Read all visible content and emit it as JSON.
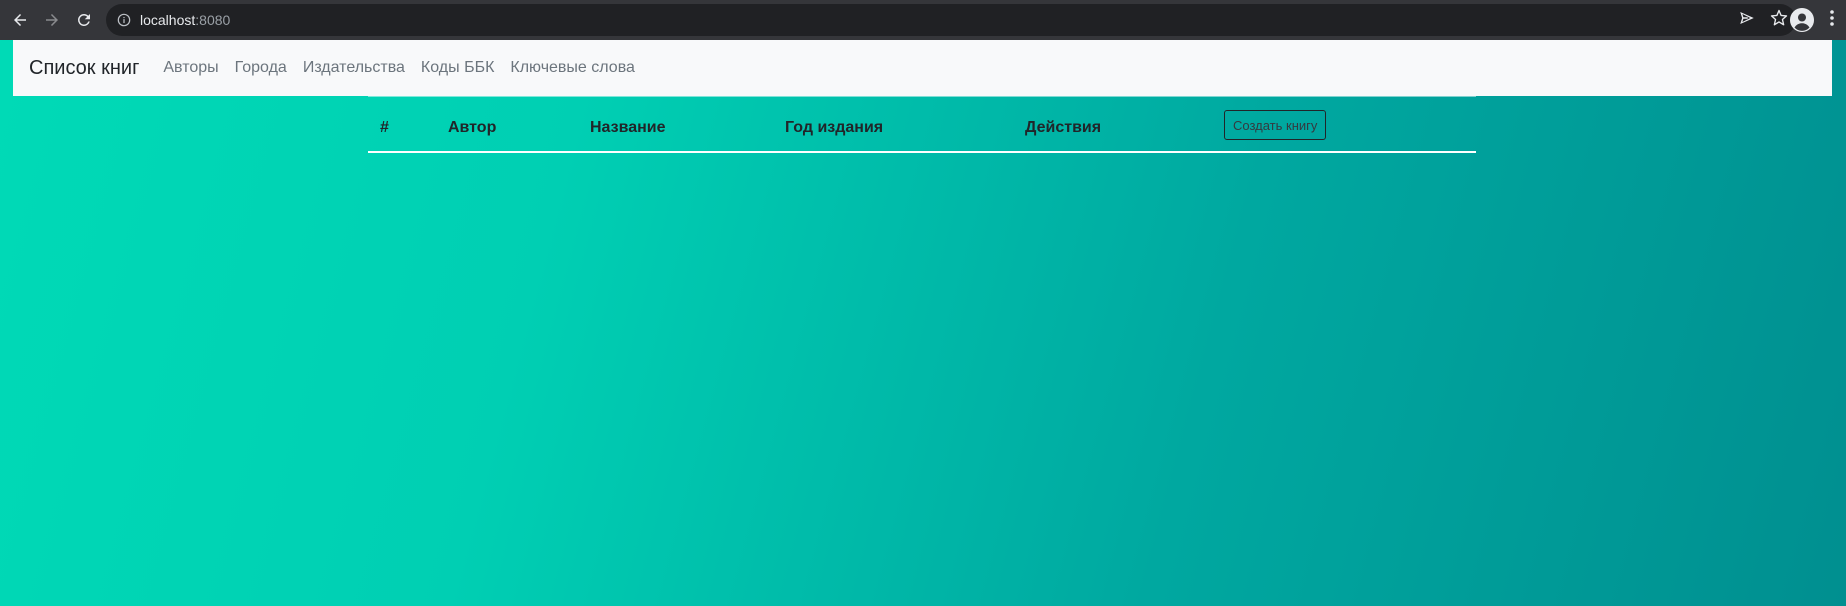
{
  "browser": {
    "url_host": "localhost",
    "url_port": ":8080"
  },
  "navbar": {
    "brand": "Список книг",
    "links": [
      "Авторы",
      "Города",
      "Издательства",
      "Коды ББК",
      "Ключевые слова"
    ]
  },
  "table": {
    "headers": [
      "#",
      "Автор",
      "Название",
      "Год издания",
      "Действия"
    ],
    "create_button": "Создать книгу",
    "rows": []
  },
  "colors": {
    "navbar_bg": "#f8f9fa",
    "gradient_start": "#00dab6",
    "gradient_end": "#008f90"
  },
  "icons": [
    "back-arrow-icon",
    "forward-arrow-icon",
    "reload-icon",
    "info-icon",
    "send-icon",
    "star-icon",
    "profile-icon",
    "more-vert-icon"
  ]
}
